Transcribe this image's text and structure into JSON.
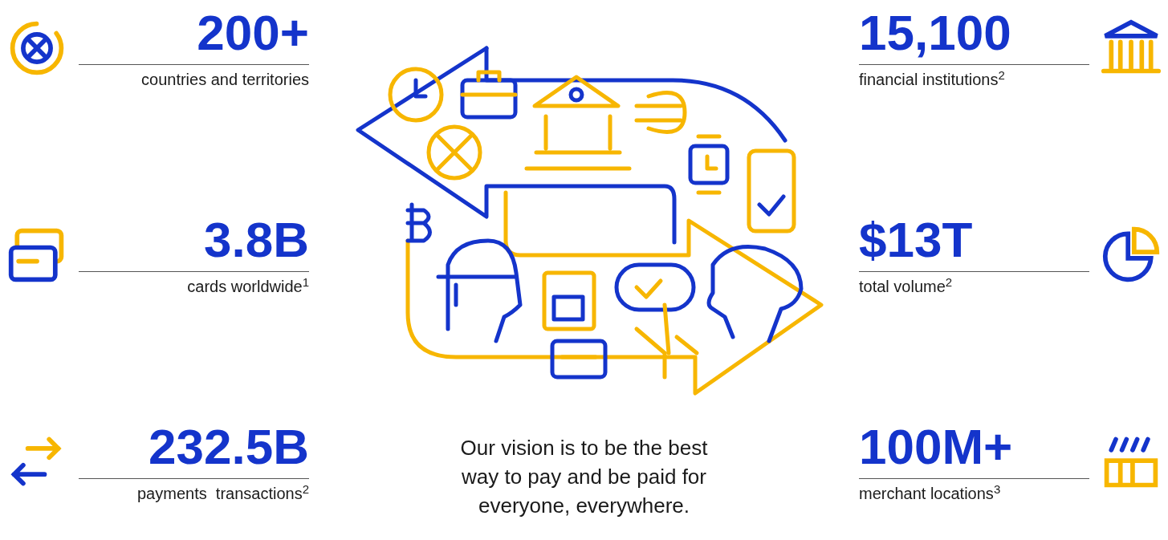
{
  "left_stats": [
    {
      "kind": "globe",
      "value": "200+",
      "label": "countries and territories"
    },
    {
      "kind": "cards",
      "value": "3.8B",
      "label": "cards worldwide$^{1}$"
    },
    {
      "kind": "arrows",
      "value": "232.5B",
      "label": "payments  transactions$^{2}$"
    }
  ],
  "right_stats": [
    {
      "kind": "bank",
      "value": "15,100",
      "label": "financial institutions$^{2}$"
    },
    {
      "kind": "pie",
      "value": "$13T",
      "label": "total volume$^{2}$"
    },
    {
      "kind": "store",
      "value": "100M+",
      "label": "merchant locations$^{3}$"
    }
  ],
  "vision": "Our vision is to be the best way to pay and be paid for everyone, everywhere."
}
